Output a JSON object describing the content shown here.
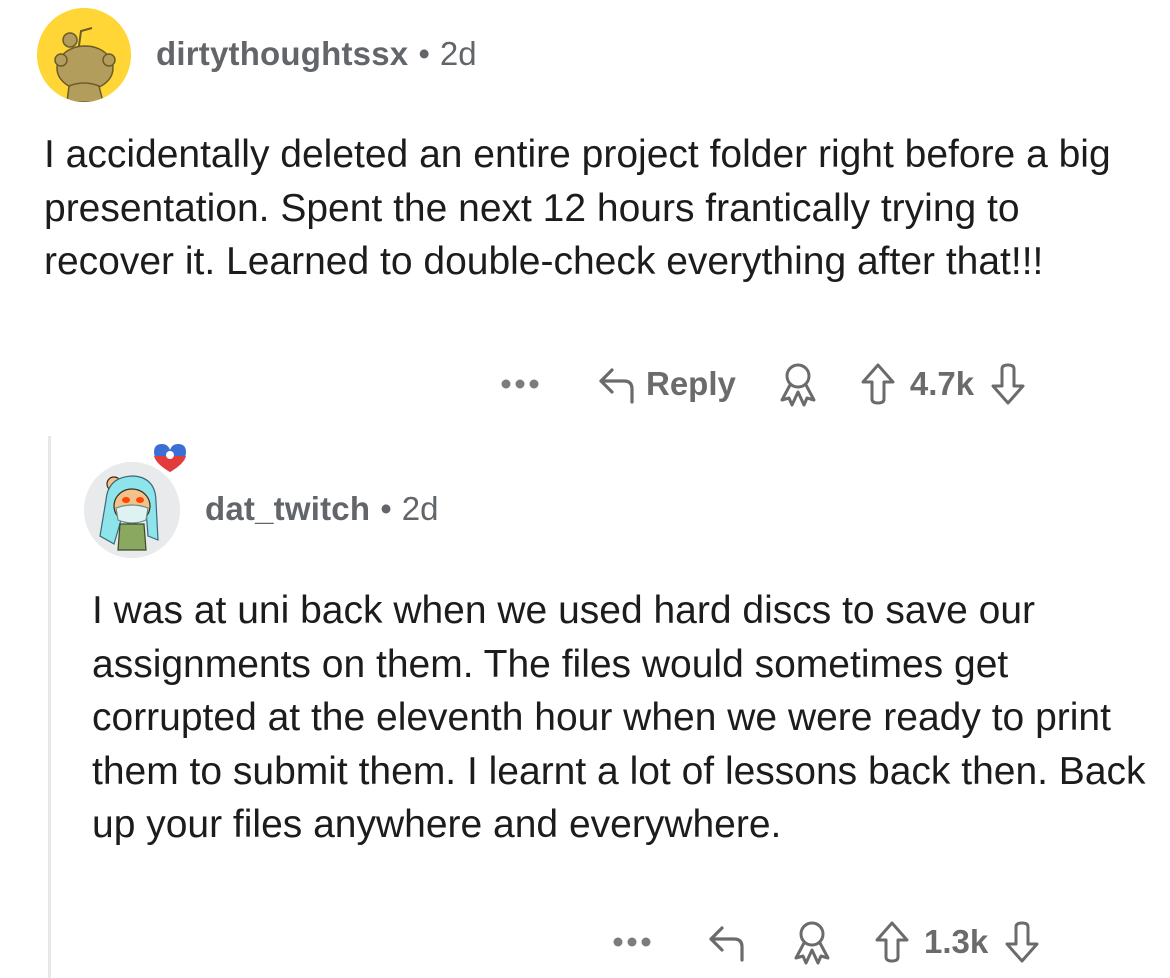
{
  "comments": [
    {
      "username": "dirtythoughtssx",
      "separator": "•",
      "age": "2d",
      "avatar": "snoo-avatar-yellow",
      "body": "I accidentally deleted an entire project folder right before a big presentation. Spent the next 12 hours frantically trying to recover it. Learned to double-check everything after that!!!",
      "actions": {
        "more_icon": "ellipsis-icon",
        "reply_label": "Reply",
        "award_icon": "award-icon",
        "upvote_icon": "upvote-arrow-icon",
        "vote_count": "4.7k",
        "downvote_icon": "downvote-arrow-icon"
      }
    },
    {
      "username": "dat_twitch",
      "separator": "•",
      "age": "2d",
      "avatar": "snoo-avatar-custom",
      "body": "I was at uni back when we used hard discs to save our assignments on them. The files would sometimes get corrupted at the eleventh hour when we were ready to print them to submit them. I learnt a lot of lessons back then. Back up your files anywhere and everywhere.",
      "actions": {
        "more_icon": "ellipsis-icon",
        "award_icon": "award-icon",
        "upvote_icon": "upvote-arrow-icon",
        "vote_count": "1.3k",
        "downvote_icon": "downvote-arrow-icon"
      }
    }
  ],
  "colors": {
    "avatar_yellow": "#ffd635",
    "meta_gray": "#626569",
    "icon_gray": "#6b6b6b",
    "text": "#1c1c1c",
    "thread_line": "#e7e7e9"
  }
}
